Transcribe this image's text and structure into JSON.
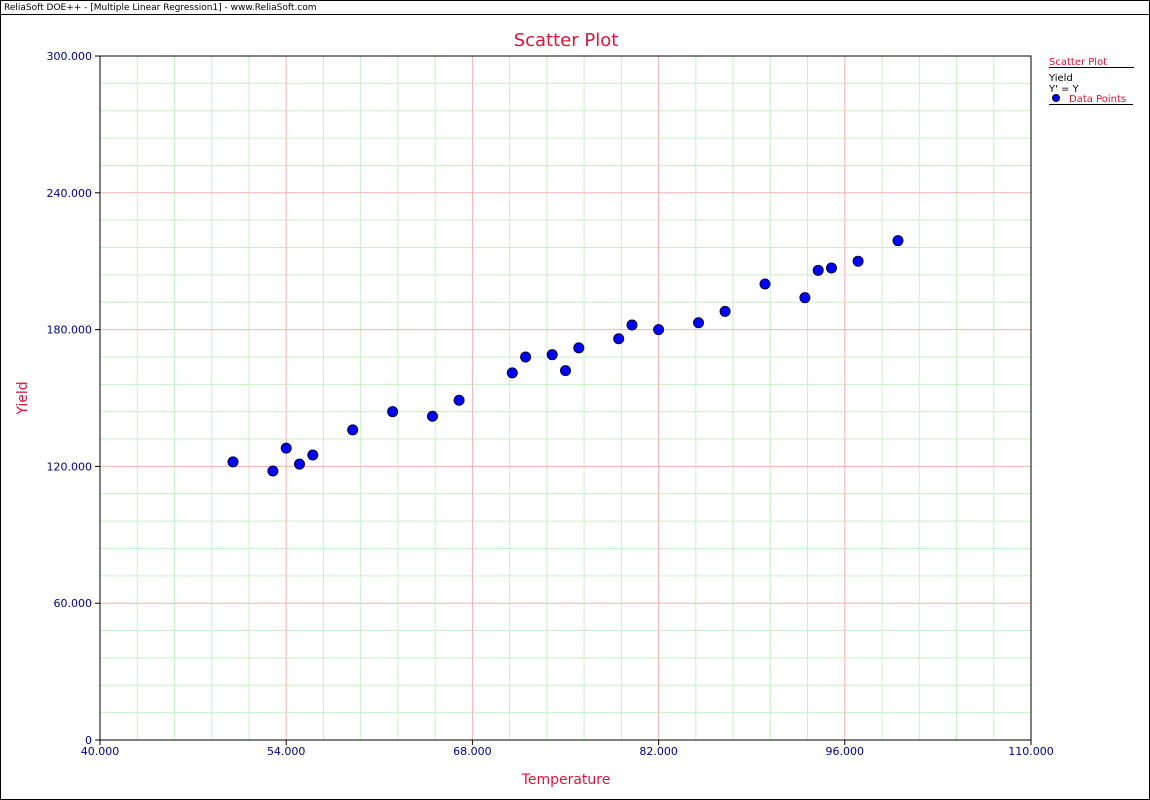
{
  "window": {
    "title": "ReliaSoft DOE++ - [Multiple Linear Regression1] - www.ReliaSoft.com"
  },
  "legend": {
    "title": "Scatter Plot",
    "series_header": "Yield",
    "equation": "Y' = Y",
    "entry_label": "Data Points"
  },
  "colors": {
    "accent": "#dc143c",
    "axis_text": "#00008b",
    "point_fill": "#0000ff",
    "major_grid": "#f4b3b3",
    "minor_grid": "#c6f2c6"
  },
  "chart_data": {
    "type": "scatter",
    "title": "Scatter Plot",
    "xlabel": "Temperature",
    "ylabel": "Yield",
    "xlim": [
      40,
      110
    ],
    "ylim": [
      0,
      300
    ],
    "grid": true,
    "legend_position": "top-right",
    "x_ticks": [
      "40.000",
      "54.000",
      "68.000",
      "82.000",
      "96.000",
      "110.000"
    ],
    "y_ticks": [
      "0",
      "60.000",
      "120.000",
      "180.000",
      "240.000",
      "300.000"
    ],
    "series": [
      {
        "name": "Data Points",
        "points": [
          {
            "x": 50,
            "y": 122
          },
          {
            "x": 53,
            "y": 118
          },
          {
            "x": 54,
            "y": 128
          },
          {
            "x": 55,
            "y": 121
          },
          {
            "x": 56,
            "y": 125
          },
          {
            "x": 59,
            "y": 136
          },
          {
            "x": 62,
            "y": 144
          },
          {
            "x": 65,
            "y": 142
          },
          {
            "x": 67,
            "y": 149
          },
          {
            "x": 71,
            "y": 161
          },
          {
            "x": 72,
            "y": 168
          },
          {
            "x": 74,
            "y": 169
          },
          {
            "x": 75,
            "y": 162
          },
          {
            "x": 76,
            "y": 172
          },
          {
            "x": 79,
            "y": 176
          },
          {
            "x": 80,
            "y": 182
          },
          {
            "x": 82,
            "y": 180
          },
          {
            "x": 85,
            "y": 183
          },
          {
            "x": 87,
            "y": 188
          },
          {
            "x": 90,
            "y": 200
          },
          {
            "x": 93,
            "y": 194
          },
          {
            "x": 94,
            "y": 206
          },
          {
            "x": 95,
            "y": 207
          },
          {
            "x": 97,
            "y": 210
          },
          {
            "x": 100,
            "y": 219
          }
        ]
      }
    ]
  }
}
